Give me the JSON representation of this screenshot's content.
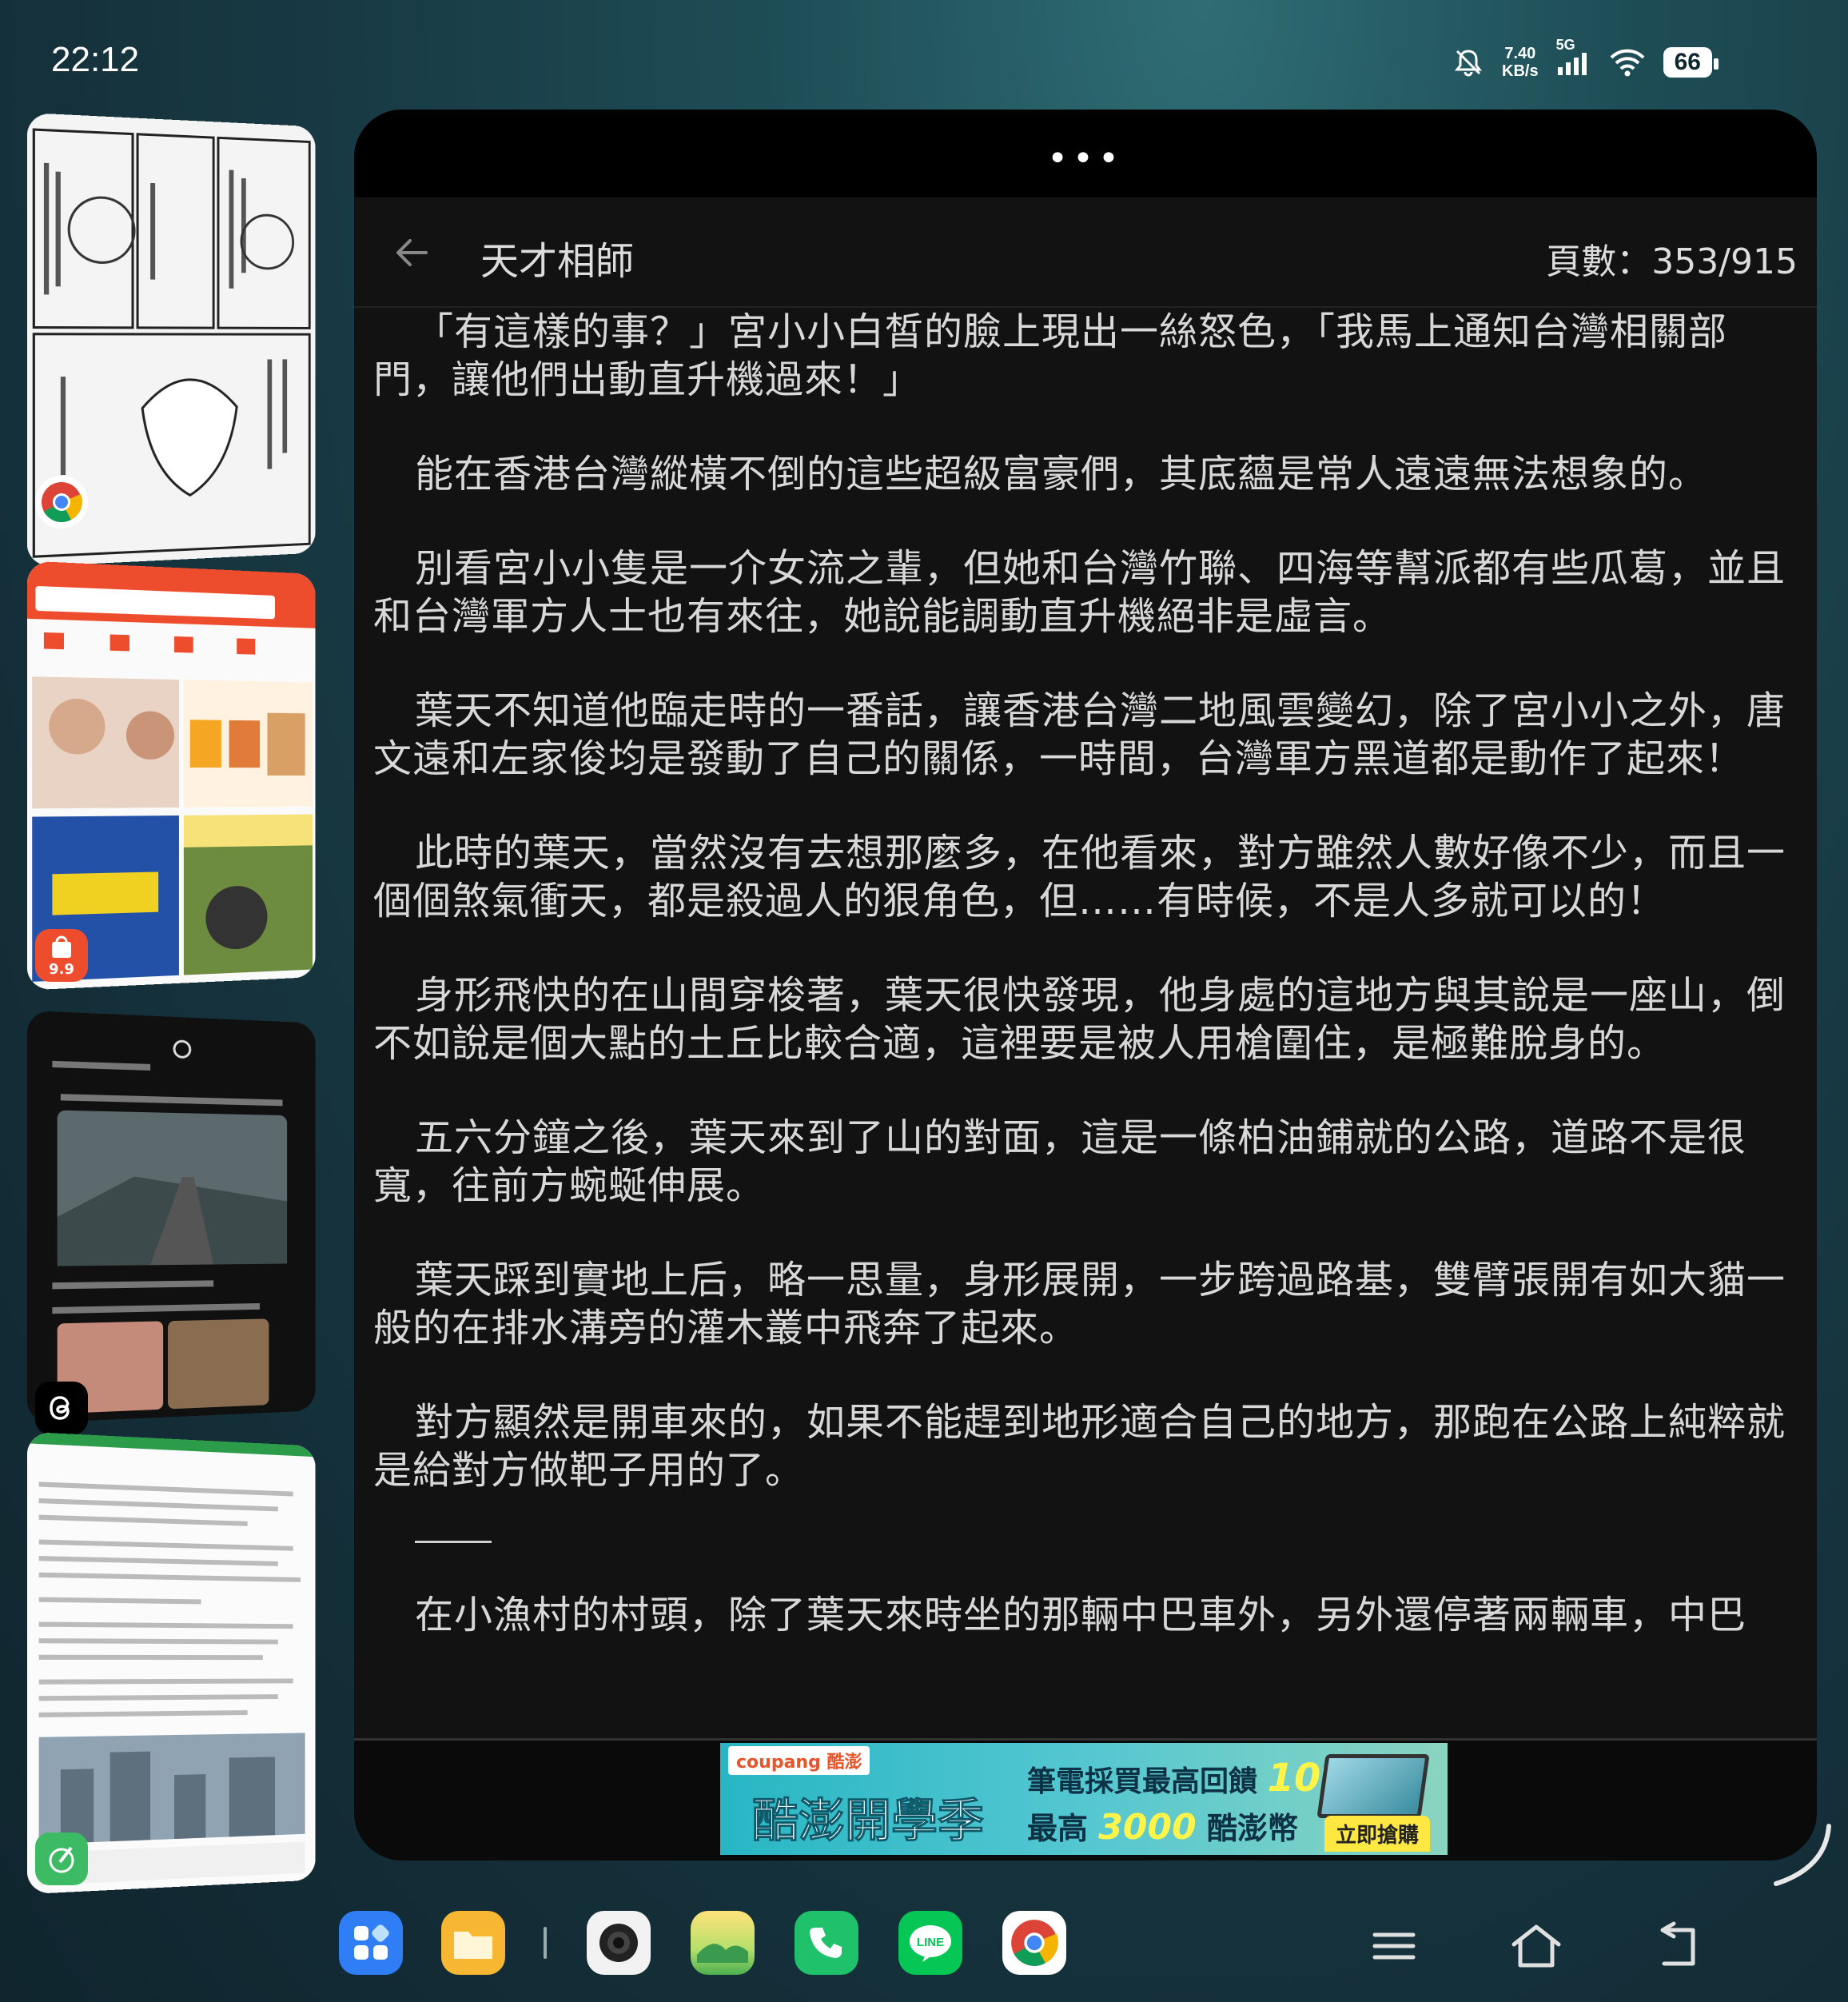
{
  "status_bar": {
    "time": "22:12",
    "net_speed_value": "7.40",
    "net_speed_unit": "KB/s",
    "network": "5G",
    "battery": "66"
  },
  "reader": {
    "title": "天才相師",
    "page_count": "頁數：353/915",
    "paragraphs": [
      "「有這樣的事？」宮小小白皙的臉上現出一絲怒色，「我馬上通知台灣相關部門，讓他們出動直升機過來！」",
      "能在香港台灣縱橫不倒的這些超級富豪們，其底蘊是常人遠遠無法想象的。",
      "別看宮小小隻是一介女流之輩，但她和台灣竹聯、四海等幫派都有些瓜葛，並且和台灣軍方人士也有來往，她說能調動直升機絕非是虛言。",
      "葉天不知道他臨走時的一番話，讓香港台灣二地風雲變幻，除了宮小小之外，唐文遠和左家俊均是發動了自己的關係，一時間，台灣軍方黑道都是動作了起來！",
      "此時的葉天，當然沒有去想那麼多，在他看來，對方雖然人數好像不少，而且一個個煞氣衝天，都是殺過人的狠角色，但……有時候，不是人多就可以的！",
      "身形飛快的在山間穿梭著，葉天很快發現，他身處的這地方與其說是一座山，倒不如說是個大點的土丘比較合適，這裡要是被人用槍圍住，是極難脫身的。",
      "五六分鐘之後，葉天來到了山的對面，這是一條柏油鋪就的公路，道路不是很寬，往前方蜿蜒伸展。",
      "葉天踩到實地上后，略一思量，身形展開，一步跨過路基，雙臂張開有如大貓一般的在排水溝旁的灌木叢中飛奔了起來。",
      "對方顯然是開車來的，如果不能趕到地形適合自己的地方，那跑在公路上純粹就是給對方做靶子用的了。"
    ],
    "last_paragraph": "在小漁村的村頭，除了葉天來時坐的那輛中巴車外，另外還停著兩輛車，中巴"
  },
  "ad": {
    "logo": "coupang 酷澎",
    "title": "酷澎開學季",
    "line1_prefix": "筆電採買最高回饋",
    "line1_value": "10%",
    "line2_prefix": "最高",
    "line2_value": "3000",
    "line2_suffix": "酷澎幣",
    "cta": "立即搶購"
  },
  "recent_apps": {
    "shopee_badge": "9.9"
  },
  "colors": {
    "reader_bg": "#121212",
    "reader_text": "#d8d8d8",
    "ad_bg": "#28b6c4"
  }
}
